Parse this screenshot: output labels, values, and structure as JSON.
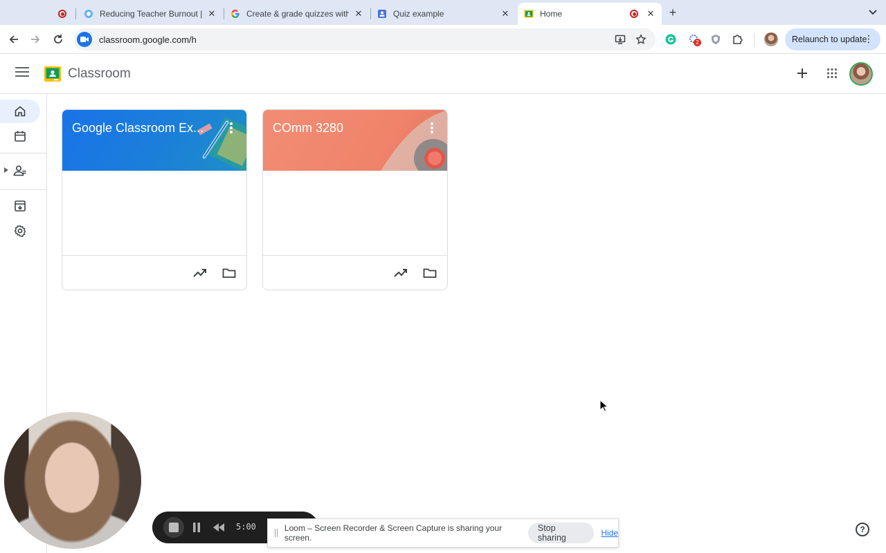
{
  "browser": {
    "tabs": [
      {
        "title": "Reducing Teacher Burnout | R",
        "icon": "loom-icon"
      },
      {
        "title": "Create & grade quizzes with G",
        "icon": "google-icon"
      },
      {
        "title": "Quiz example",
        "icon": "forms-icon"
      },
      {
        "title": "Home",
        "icon": "classroom-icon",
        "active": true
      }
    ],
    "url": "classroom.google.com/h",
    "relaunch_label": "Relaunch to update",
    "extension_badge": "2"
  },
  "app": {
    "title": "Classroom"
  },
  "sidebar": {
    "items": [
      "home-icon",
      "calendar-icon",
      "enrolled-icon",
      "archive-icon",
      "settings-icon"
    ]
  },
  "courses": [
    {
      "title": "Google Classroom Ex...",
      "color": "#1a73e8"
    },
    {
      "title": "COmm 3280",
      "color": "#f18d74"
    }
  ],
  "recorder": {
    "time": "5:00"
  },
  "share_banner": {
    "message": "Loom – Screen Recorder & Screen Capture is sharing your screen.",
    "stop_label": "Stop sharing",
    "hide_label": "Hide"
  },
  "help": {
    "label": "?"
  }
}
